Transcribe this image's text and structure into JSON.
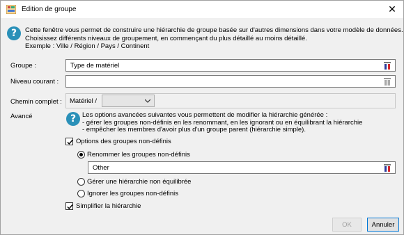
{
  "window": {
    "title": "Edition de groupe",
    "close_glyph": "✕"
  },
  "info": {
    "icon": "question-icon",
    "glyph": "?",
    "lines": [
      "Cette fenêtre vous permet de construire une hiérarchie de groupe basée sur d'autres dimensions dans votre modèle de données.",
      "Choisissez différents niveaux de groupement, en commençant du plus détaillé au moins détaillé.",
      "Exemple : Ville / Région / Pays / Continent"
    ]
  },
  "form": {
    "groupe_label": "Groupe :",
    "groupe_value": "Type de matériel",
    "niveau_label": "Niveau courant :",
    "niveau_value": "",
    "chemin_label": "Chemin complet :",
    "chemin_value": "Matériel /",
    "chemin_select_value": ""
  },
  "advanced": {
    "label": "Avancé",
    "glyph": "?",
    "lines": [
      "Les options avancées suivantes vous permettent de modifier la hiérarchie générée :",
      "- gérer les groupes non-définis en les renommant, en les ignorant ou en équilibrant la hiérarchie",
      "- empêcher les membres d'avoir plus d'un groupe parent (hiérarchie simple)."
    ],
    "options_label": "Options des groupes non-définis",
    "options_checked": true,
    "rename_label": "Renommer les groupes non-définis",
    "rename_value": "Other",
    "unbalanced_label": "Gérer une hiérarchie non équilibrée",
    "ignore_label": "Ignorer les groupes non-définis",
    "selected_option": "rename",
    "simplify_label": "Simplifier la hiérarchie",
    "simplify_checked": true
  },
  "buttons": {
    "ok": "OK",
    "cancel": "Annuler"
  },
  "colors": {
    "info_icon": "#2a90b8",
    "flag_blue": "#2b3b9a",
    "flag_red": "#d4282c"
  }
}
